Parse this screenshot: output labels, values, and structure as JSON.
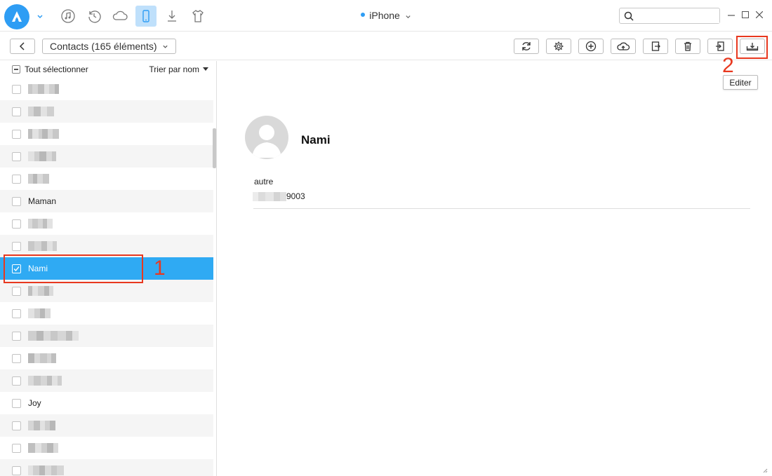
{
  "titlebar": {
    "device_name": "iPhone",
    "search_placeholder": "",
    "nav_icons": [
      "music-icon",
      "restore-icon",
      "cloud-icon",
      "phone-icon",
      "download-icon",
      "shirt-icon"
    ]
  },
  "toolbar": {
    "category_label": "Contacts (165 éléments)",
    "buttons": [
      "refresh-icon",
      "settings-icon",
      "add-icon",
      "upload-cloud-icon",
      "export-icon",
      "delete-icon",
      "import-icon",
      "edit-icon"
    ]
  },
  "list": {
    "select_all_label": "Tout sélectionner",
    "sort_label": "Trier par nom",
    "rows": [
      {
        "name": "",
        "selected": false
      },
      {
        "name": "",
        "selected": false
      },
      {
        "name": "",
        "selected": false
      },
      {
        "name": "",
        "selected": false
      },
      {
        "name": "",
        "selected": false
      },
      {
        "name": "Maman",
        "selected": false
      },
      {
        "name": "",
        "selected": false
      },
      {
        "name": "",
        "selected": false
      },
      {
        "name": "Nami",
        "selected": true
      },
      {
        "name": "",
        "selected": false
      },
      {
        "name": "",
        "selected": false
      },
      {
        "name": "",
        "selected": false
      },
      {
        "name": "",
        "selected": false
      },
      {
        "name": "",
        "selected": false
      },
      {
        "name": "Joy",
        "selected": false
      },
      {
        "name": "",
        "selected": false
      },
      {
        "name": "",
        "selected": false
      },
      {
        "name": "",
        "selected": false
      }
    ]
  },
  "detail": {
    "name": "Nami",
    "field_label": "autre",
    "field_value_suffix": "9003"
  },
  "tooltip": "Editer",
  "annotations": {
    "step1": "1",
    "step2": "2"
  },
  "colors": {
    "accent": "#2faaf3",
    "annotation": "#e8381f"
  }
}
